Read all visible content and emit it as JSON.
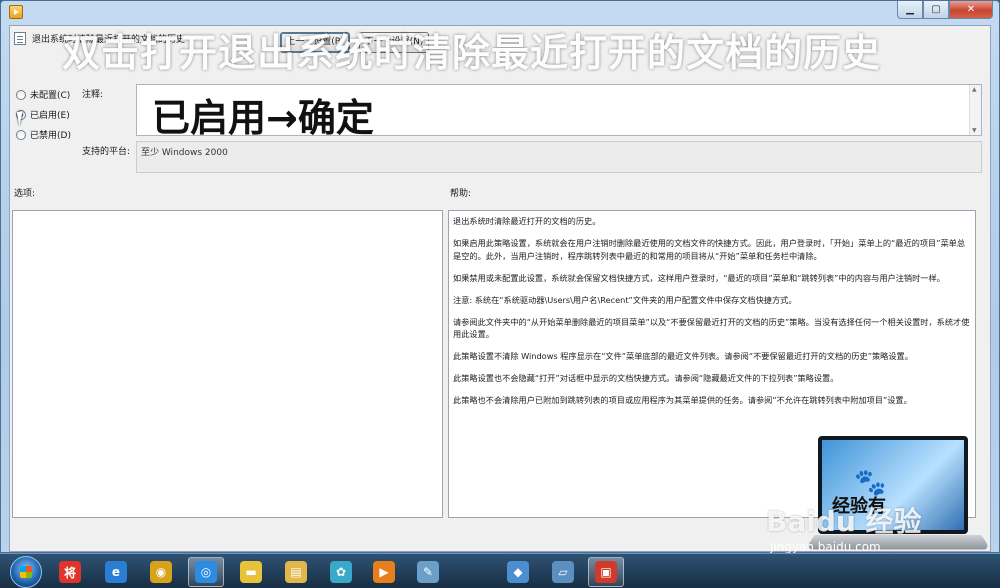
{
  "window": {
    "title": "退出系统时清除最近打开的文档的历史",
    "controls": {
      "minimize": "▁",
      "maximize": "▢",
      "close": "✕"
    }
  },
  "header": {
    "policy_title": "退出系统时清除最近打开的文档的历史",
    "prev_button": "上一个设置(P)",
    "next_button": "下一个设置(N)"
  },
  "radios": [
    {
      "label": "未配置(C)",
      "selected": false
    },
    {
      "label": "已启用(E)",
      "selected": true
    },
    {
      "label": "已禁用(D)",
      "selected": false
    }
  ],
  "labels": {
    "note": "注释:",
    "platform": "支持的平台:",
    "options": "选项:",
    "help": "帮助:"
  },
  "platform_value": "至少 Windows 2000",
  "help_paragraphs": [
    "退出系统时清除最近打开的文档的历史。",
    "如果启用此策略设置，系统就会在用户注销时删除最近使用的文档文件的快捷方式。因此，用户登录时，「开始」菜单上的“最近的项目”菜单总是空的。此外，当用户注销时，程序跳转列表中最近的和常用的项目将从“开始”菜单和任务栏中清除。",
    "如果禁用或未配置此设置，系统就会保留文档快捷方式，这样用户登录时，“最近的项目”菜单和“跳转列表”中的内容与用户注销时一样。",
    "注意: 系统在“系统驱动器\\Users\\用户名\\Recent”文件夹的用户配置文件中保存文档快捷方式。",
    "请参阅此文件夹中的“从开始菜单删除最近的项目菜单”以及“不要保留最近打开的文档的历史”策略。当没有选择任何一个相关设置时，系统才使用此设置。",
    "此策略设置不清除 Windows 程序显示在“文件”菜单底部的最近文件列表。请参阅“不要保留最近打开的文档的历史”策略设置。",
    "此策略设置也不会隐藏“打开”对话框中显示的文档快捷方式。请参阅“隐藏最近文件的下拉列表”策略设置。",
    "此策略也不会清除用户已附加到跳转列表的项目或应用程序为其菜单提供的任务。请参阅“不允许在跳转列表中附加项目”设置。"
  ],
  "overlay": {
    "title": "双击打开退出系统时清除最近打开的文档的历史",
    "caption": "已启用→确定",
    "laptop_text": "经验有",
    "watermark": "Baidu 经验",
    "watermark_url": "jingyan.baidu.com"
  },
  "taskbar": {
    "items": [
      {
        "name": "jiang-app",
        "glyph": "将",
        "color": "#e0342a"
      },
      {
        "name": "ie",
        "glyph": "e",
        "color": "#2a7fd4"
      },
      {
        "name": "chrome",
        "glyph": "◉",
        "color": "#d9a21b"
      },
      {
        "name": "qq-browser",
        "glyph": "◎",
        "color": "#2b8ce0"
      },
      {
        "name": "notes",
        "glyph": "▬",
        "color": "#e8c23a"
      },
      {
        "name": "explorer",
        "glyph": "▤",
        "color": "#e2b64a"
      },
      {
        "name": "pinwheel",
        "glyph": "✿",
        "color": "#3aa8c8"
      },
      {
        "name": "media-player",
        "glyph": "▶",
        "color": "#e87f1c"
      },
      {
        "name": "paint",
        "glyph": "✎",
        "color": "#6b9ec8"
      },
      {
        "name": "cube",
        "glyph": "◆",
        "color": "#4b8fd0"
      },
      {
        "name": "window-app",
        "glyph": "▱",
        "color": "#5a8fbf"
      },
      {
        "name": "toolbox",
        "glyph": "▣",
        "color": "#d03a2a"
      }
    ]
  }
}
